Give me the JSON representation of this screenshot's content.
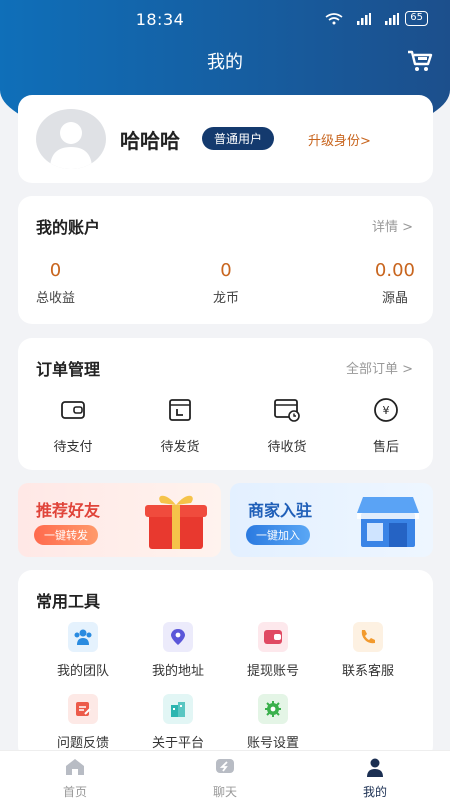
{
  "status": {
    "time": "18:34",
    "battery": "65"
  },
  "header": {
    "title": "我的"
  },
  "profile": {
    "name": "哈哈哈",
    "badge": "普通用户",
    "upgrade": "升级身份>"
  },
  "account": {
    "title": "我的账户",
    "detail": "详情 >",
    "stats": [
      {
        "value": "0",
        "label": "总收益"
      },
      {
        "value": "0",
        "label": "龙币"
      },
      {
        "value": "0.00",
        "label": "源晶"
      }
    ]
  },
  "orders": {
    "title": "订单管理",
    "all": "全部订单 >",
    "items": [
      {
        "label": "待支付",
        "icon": "wallet-icon"
      },
      {
        "label": "待发货",
        "icon": "package-icon"
      },
      {
        "label": "待收货",
        "icon": "truck-clock-icon"
      },
      {
        "label": "售后",
        "icon": "yen-icon"
      }
    ]
  },
  "promos": {
    "friends": {
      "title": "推荐好友",
      "button": "一键转发"
    },
    "merchant": {
      "title": "商家入驻",
      "button": "一键加入"
    }
  },
  "tools": {
    "title": "常用工具",
    "items": [
      {
        "label": "我的团队",
        "icon": "team-icon",
        "color": "#2a8be0"
      },
      {
        "label": "我的地址",
        "icon": "location-icon",
        "color": "#5b57d9"
      },
      {
        "label": "提现账号",
        "icon": "wallet-icon",
        "color": "#e04a63"
      },
      {
        "label": "联系客服",
        "icon": "phone-icon",
        "color": "#f29a2e"
      },
      {
        "label": "问题反馈",
        "icon": "feedback-icon",
        "color": "#ec5b4a"
      },
      {
        "label": "关于平台",
        "icon": "building-icon",
        "color": "#2bb5b0"
      },
      {
        "label": "账号设置",
        "icon": "gear-icon",
        "color": "#3ab04c"
      }
    ]
  },
  "nav": {
    "items": [
      {
        "label": "首页",
        "icon": "home-icon"
      },
      {
        "label": "聊天",
        "icon": "chat-icon"
      },
      {
        "label": "我的",
        "icon": "profile-icon"
      }
    ]
  },
  "colors": {
    "header": "#1563a8",
    "accent": "#c8651e",
    "badge": "#143a6e"
  }
}
